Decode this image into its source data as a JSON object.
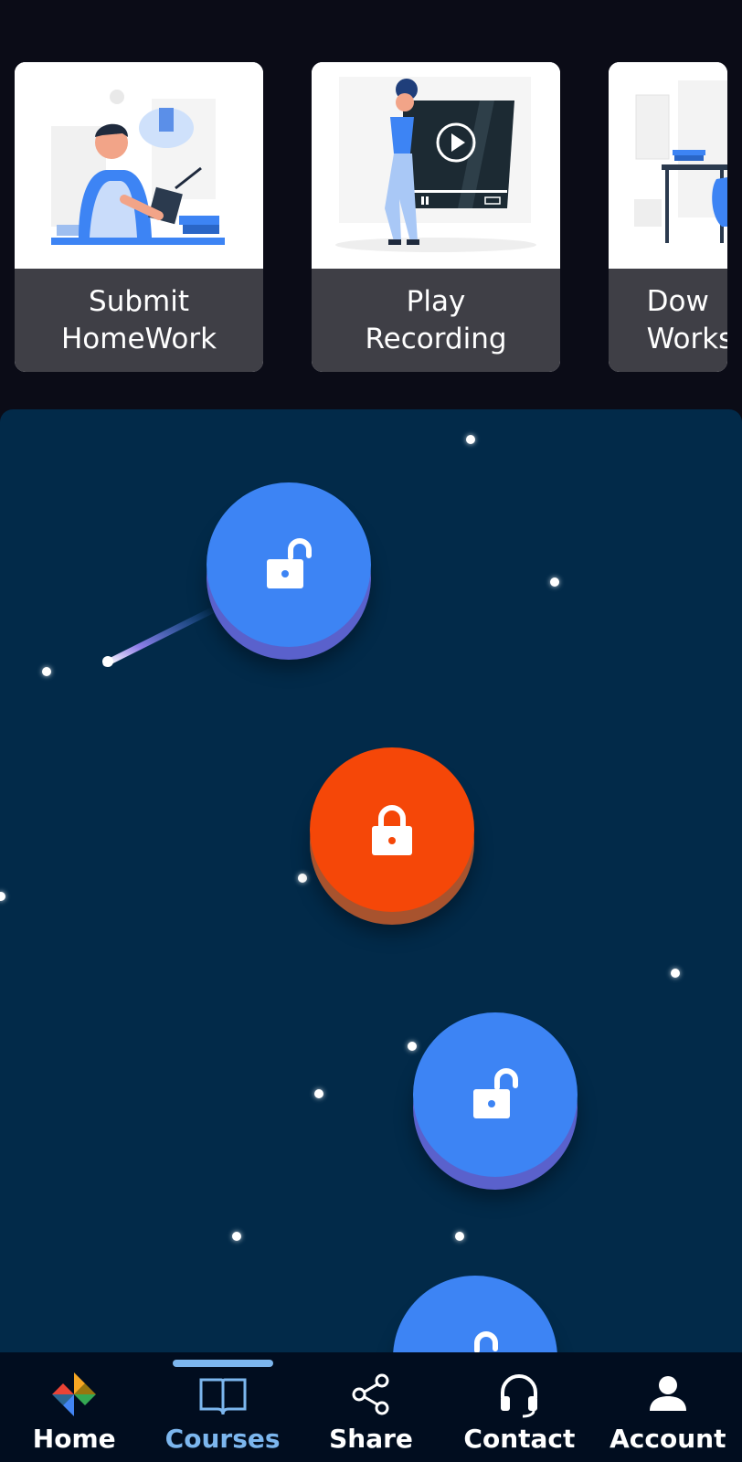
{
  "cards": [
    {
      "label": "Submit\nHomeWork",
      "icon": "homework-illustration"
    },
    {
      "label": "Play\nRecording",
      "icon": "video-player-illustration"
    },
    {
      "label": "Dow\nWorks",
      "icon": "desk-illustration"
    }
  ],
  "levels": [
    {
      "state": "unlocked",
      "icon": "unlocked-padlock-icon",
      "color": "#3d84f4"
    },
    {
      "state": "locked",
      "icon": "locked-padlock-icon",
      "color": "#f54708"
    },
    {
      "state": "unlocked",
      "icon": "unlocked-padlock-icon",
      "color": "#3d84f4"
    },
    {
      "state": "unlocked",
      "icon": "unlocked-padlock-icon",
      "color": "#3d84f4"
    }
  ],
  "nav": {
    "items": [
      {
        "label": "Home",
        "icon": "pinwheel-icon"
      },
      {
        "label": "Courses",
        "icon": "open-book-icon",
        "active": true
      },
      {
        "label": "Share",
        "icon": "share-icon"
      },
      {
        "label": "Contact",
        "icon": "headset-icon"
      },
      {
        "label": "Account",
        "icon": "person-icon"
      }
    ]
  },
  "colors": {
    "background": "#0b0c17",
    "map": "#022a49",
    "card_label_bg": "#3f3f46",
    "accent": "#7cb6ee",
    "unlocked": "#3d84f4",
    "locked": "#f54708"
  }
}
